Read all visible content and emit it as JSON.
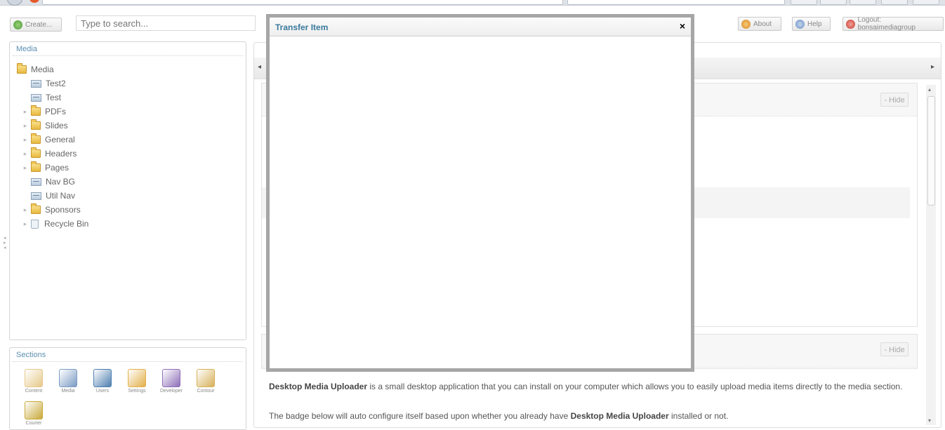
{
  "toolbar": {
    "create_label": "Create...",
    "search_placeholder": "Type to search...",
    "about_label": "About",
    "help_label": "Help",
    "logout_label": "Logout: bonsaimediagroup"
  },
  "media_panel": {
    "title": "Media",
    "tree": [
      {
        "label": "Media",
        "type": "folder",
        "level": 0,
        "expandable": false
      },
      {
        "label": "Test2",
        "type": "image",
        "level": 1,
        "expandable": false
      },
      {
        "label": "Test",
        "type": "image",
        "level": 1,
        "expandable": false
      },
      {
        "label": "PDFs",
        "type": "folder",
        "level": 1,
        "expandable": true
      },
      {
        "label": "Slides",
        "type": "folder",
        "level": 1,
        "expandable": true
      },
      {
        "label": "General",
        "type": "folder",
        "level": 1,
        "expandable": true
      },
      {
        "label": "Headers",
        "type": "folder",
        "level": 1,
        "expandable": true
      },
      {
        "label": "Pages",
        "type": "folder",
        "level": 1,
        "expandable": true
      },
      {
        "label": "Nav BG",
        "type": "image",
        "level": 1,
        "expandable": false
      },
      {
        "label": "Util Nav",
        "type": "image",
        "level": 1,
        "expandable": false
      },
      {
        "label": "Sponsors",
        "type": "folder",
        "level": 1,
        "expandable": true
      },
      {
        "label": "Recycle Bin",
        "type": "bin",
        "level": 1,
        "expandable": true
      }
    ]
  },
  "sections_panel": {
    "title": "Sections",
    "items": [
      {
        "label": "Content",
        "icon": "content-icon",
        "color": "#e6c98a"
      },
      {
        "label": "Media",
        "icon": "media-icon",
        "color": "#7c9cc4"
      },
      {
        "label": "Users",
        "icon": "users-icon",
        "color": "#4f7fb0"
      },
      {
        "label": "Settings",
        "icon": "settings-icon",
        "color": "#e2b04a"
      },
      {
        "label": "Developer",
        "icon": "developer-icon",
        "color": "#8e6fb8"
      },
      {
        "label": "Contour",
        "icon": "contour-icon",
        "color": "#d7b15a"
      },
      {
        "label": "Courier",
        "icon": "courier-icon",
        "color": "#c8a93a"
      }
    ]
  },
  "content": {
    "hide_label_1": "- Hide",
    "hide_label_2": "- Hide",
    "desc_line1_strong": "Desktop Media Uploader",
    "desc_line1_rest": " is a small desktop application that you can install on your computer which allows you to easily upload media items directly to the media section.",
    "desc_line2_pre": "The badge below will auto configure itself based upon whether you already have ",
    "desc_line2_strong": "Desktop Media Uploader",
    "desc_line2_post": " installed or not."
  },
  "modal": {
    "title": "Transfer Item",
    "close_glyph": "×"
  }
}
